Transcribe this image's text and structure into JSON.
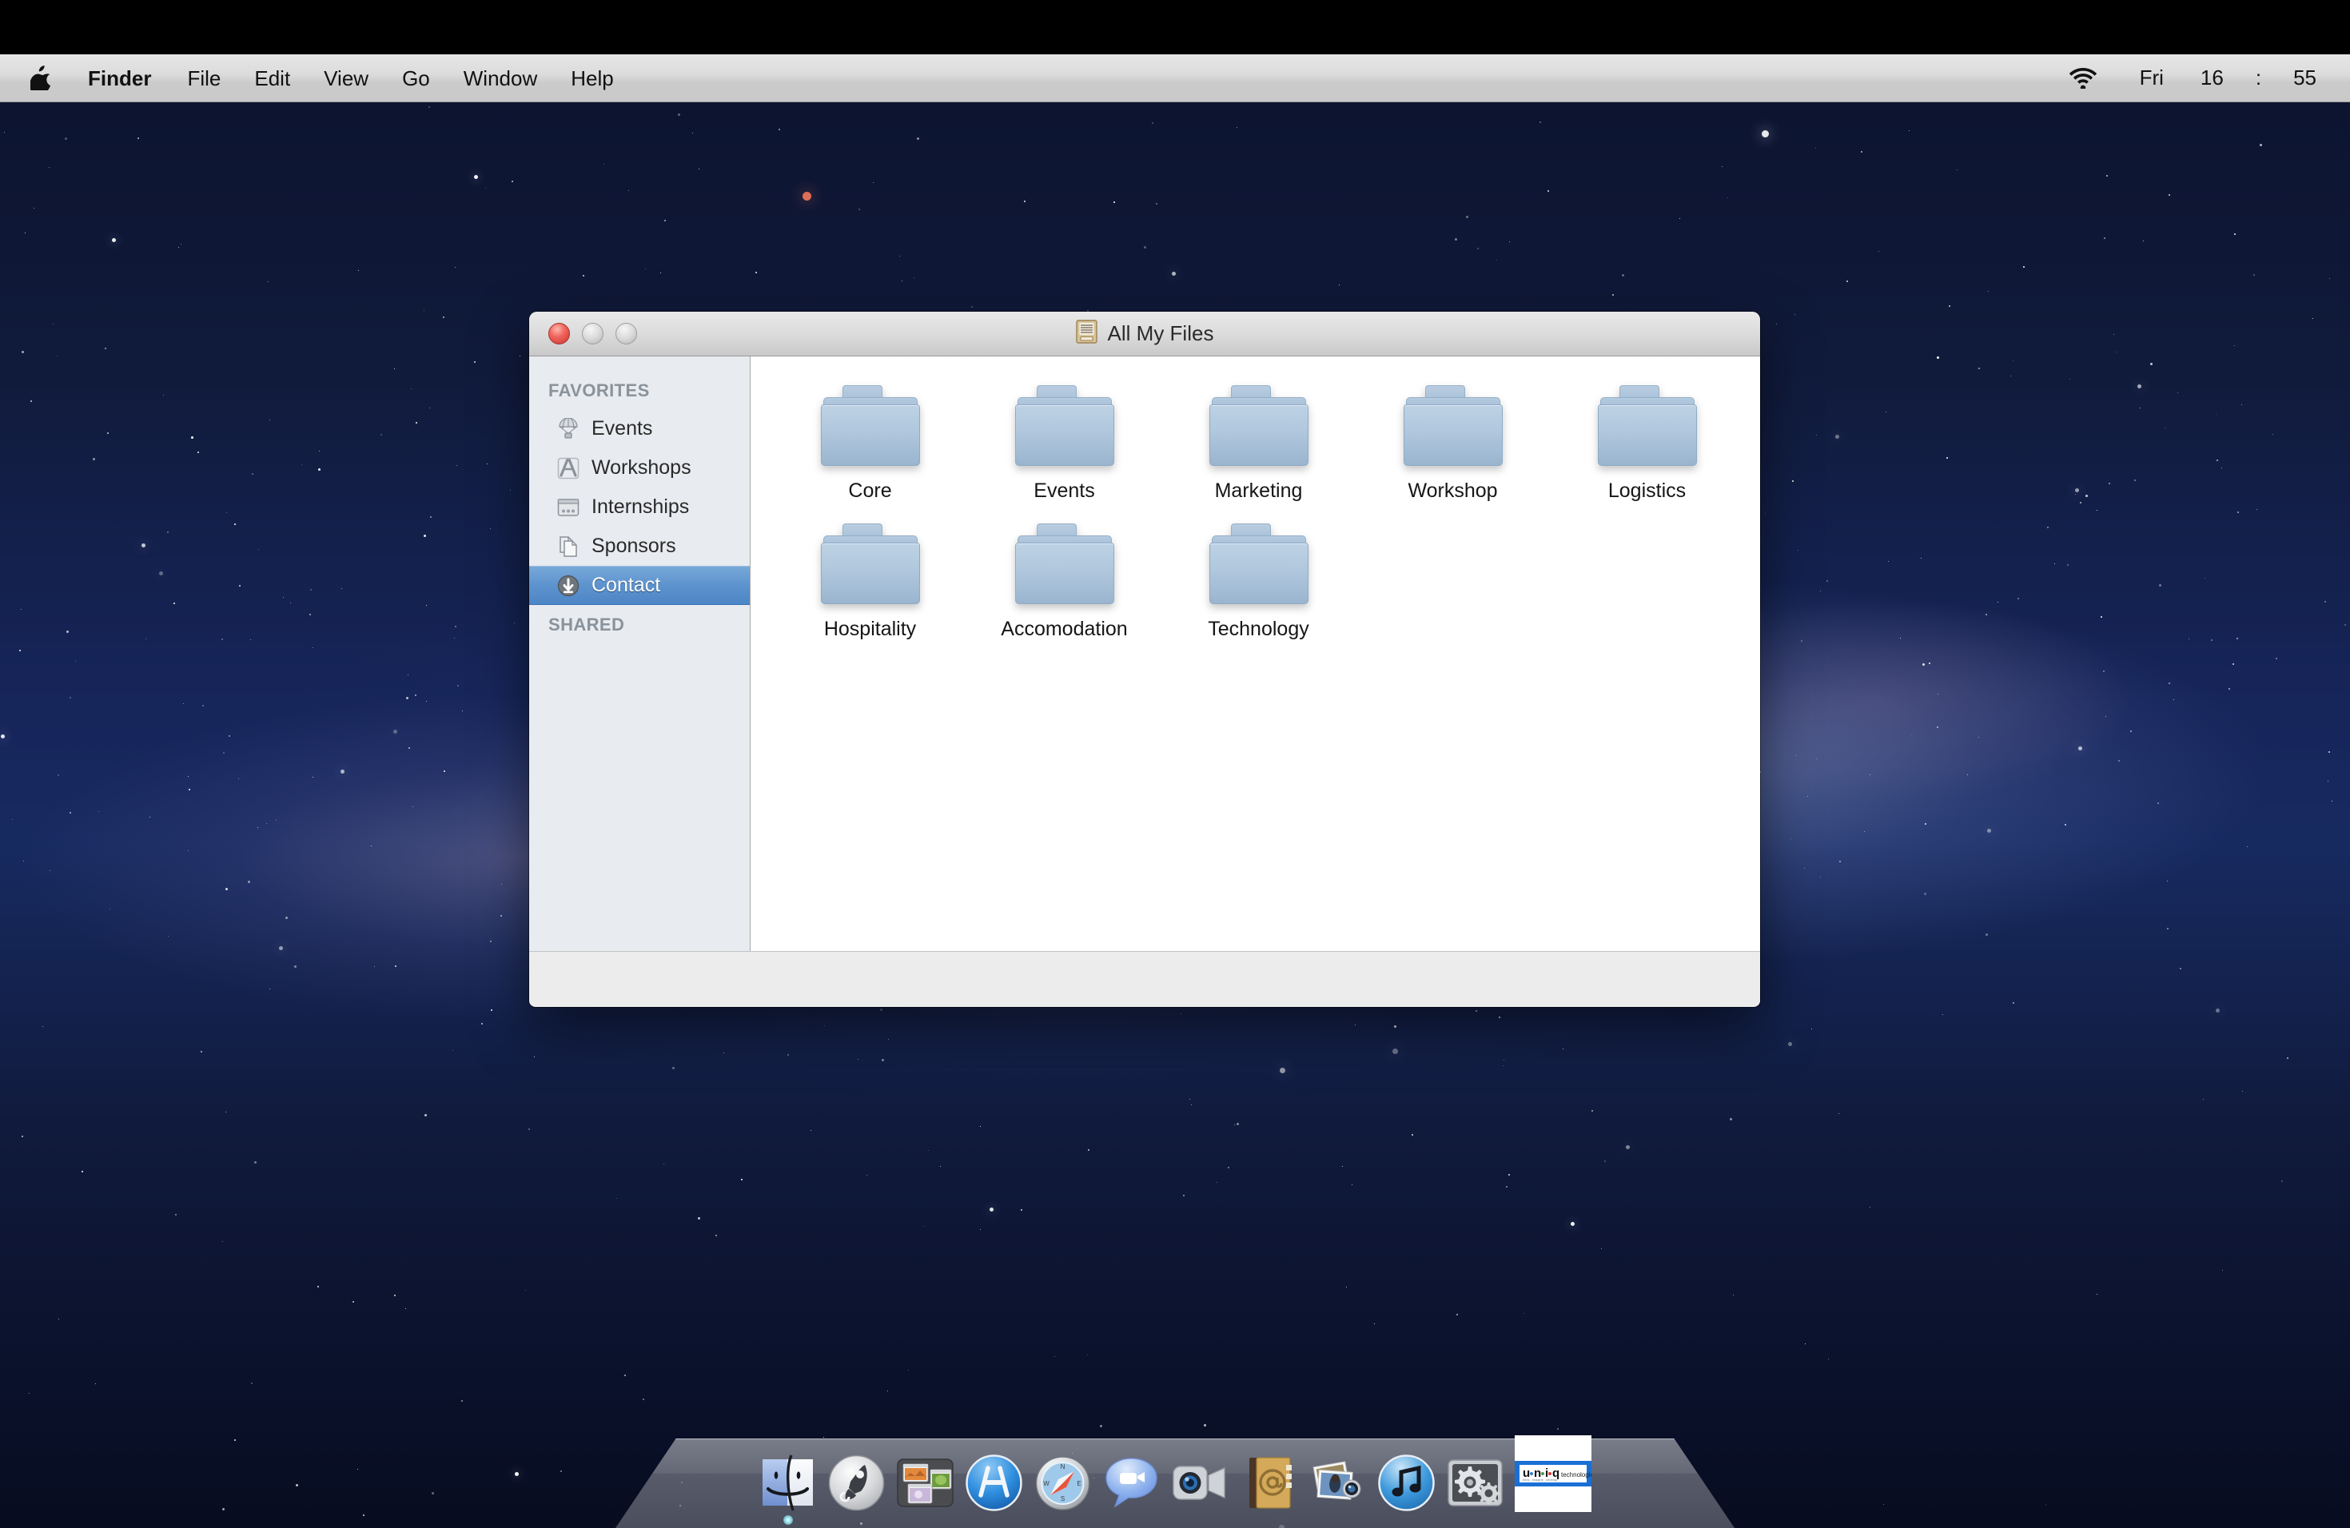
{
  "menubar": {
    "apple_icon": "apple-logo-icon",
    "items": [
      {
        "label": "Finder",
        "bold": true
      },
      {
        "label": "File",
        "bold": false
      },
      {
        "label": "Edit",
        "bold": false
      },
      {
        "label": "View",
        "bold": false
      },
      {
        "label": "Go",
        "bold": false
      },
      {
        "label": "Window",
        "bold": false
      },
      {
        "label": "Help",
        "bold": false
      }
    ],
    "status": {
      "wifi_icon": "wifi-icon",
      "day": "Fri",
      "hour": "16",
      "separator": ":",
      "minute": "55"
    }
  },
  "finder_window": {
    "title": "All My Files",
    "title_icon": "all-my-files-icon",
    "traffic_lights": {
      "close": "close-button",
      "minimize": "minimize-button",
      "zoom": "zoom-button"
    },
    "sidebar": {
      "sections": [
        {
          "header": "FAVORITES",
          "items": [
            {
              "label": "Events",
              "icon": "airdrop-parachute-icon",
              "selected": false
            },
            {
              "label": "Workshops",
              "icon": "applications-a-icon",
              "selected": false
            },
            {
              "label": "Internships",
              "icon": "desktop-window-icon",
              "selected": false
            },
            {
              "label": "Sponsors",
              "icon": "documents-pages-icon",
              "selected": false
            },
            {
              "label": "Contact",
              "icon": "downloads-arrow-icon",
              "selected": true
            }
          ]
        },
        {
          "header": "SHARED",
          "items": []
        }
      ]
    },
    "content": {
      "rows": [
        [
          {
            "label": "Core",
            "icon": "folder-icon"
          },
          {
            "label": "Events",
            "icon": "folder-icon"
          },
          {
            "label": "Marketing",
            "icon": "folder-icon"
          },
          {
            "label": "Workshop",
            "icon": "folder-icon"
          },
          {
            "label": "Logistics",
            "icon": "folder-icon"
          }
        ],
        [
          {
            "label": "Hospitality",
            "icon": "folder-icon"
          },
          {
            "label": "Accomodation",
            "icon": "folder-icon"
          },
          {
            "label": "Technology",
            "icon": "folder-icon"
          }
        ]
      ]
    },
    "status_bar_text": ""
  },
  "dock": {
    "items": [
      {
        "name": "finder",
        "running": true
      },
      {
        "name": "launchpad",
        "running": false
      },
      {
        "name": "mission-control",
        "running": false
      },
      {
        "name": "app-store",
        "running": false
      },
      {
        "name": "safari",
        "running": false
      },
      {
        "name": "messages",
        "running": false
      },
      {
        "name": "facetime",
        "running": false
      },
      {
        "name": "address-book",
        "running": false
      },
      {
        "name": "iphoto",
        "running": false
      },
      {
        "name": "itunes",
        "running": false
      },
      {
        "name": "system-preferences",
        "running": false
      },
      {
        "name": "uniq-technologies-logo",
        "running": false
      }
    ],
    "logo_text": {
      "brand": "u·n·i·q",
      "suffix": "technologies"
    }
  },
  "colors": {
    "selection_blue": "#5d93ce",
    "folder_blue": "#b0c7dd",
    "menubar_gray": "#dcdcdc",
    "desktop_navy": "#16255a",
    "logo_band": "#1a6fd4"
  }
}
